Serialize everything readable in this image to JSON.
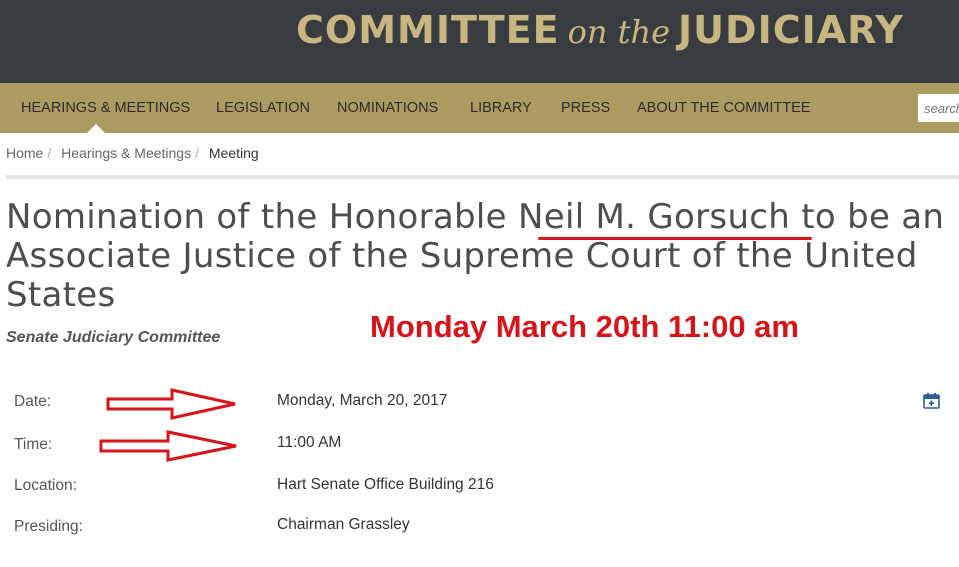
{
  "header": {
    "title_left": "COMMITTEE",
    "title_mid": "on the",
    "title_right": "JUDICIARY"
  },
  "nav": {
    "items": [
      {
        "label": "HEARINGS & MEETINGS",
        "active": true
      },
      {
        "label": "LEGISLATION"
      },
      {
        "label": "NOMINATIONS"
      },
      {
        "label": "LIBRARY"
      },
      {
        "label": "PRESS"
      },
      {
        "label": "ABOUT THE COMMITTEE"
      }
    ],
    "search_placeholder": "search"
  },
  "breadcrumb": {
    "items": [
      "Home",
      "Hearings & Meetings"
    ],
    "current": "Meeting"
  },
  "page": {
    "title_part1": "Nomination of the Honorable ",
    "title_name": "Neil M. Gorsuch",
    "title_part2": " to be an Associate Justice of the Supreme Court of the United States",
    "subtitle": "Senate Judiciary Committee",
    "annotation": "Monday March 20th 11:00 am"
  },
  "details": [
    {
      "label": "Date:",
      "value": "Monday, March 20, 2017"
    },
    {
      "label": "Time:",
      "value": "11:00 AM"
    },
    {
      "label": "Location:",
      "value": "Hart Senate Office Building 216"
    },
    {
      "label": "Presiding:",
      "value": "Chairman Grassley"
    }
  ],
  "colors": {
    "header_bg": "#383b40",
    "gold": "#c7b680",
    "nav_bg": "#ad9c62",
    "annotation_red": "#d7141a"
  },
  "icons": [
    "calendar-add-icon",
    "red-arrow-icon"
  ]
}
